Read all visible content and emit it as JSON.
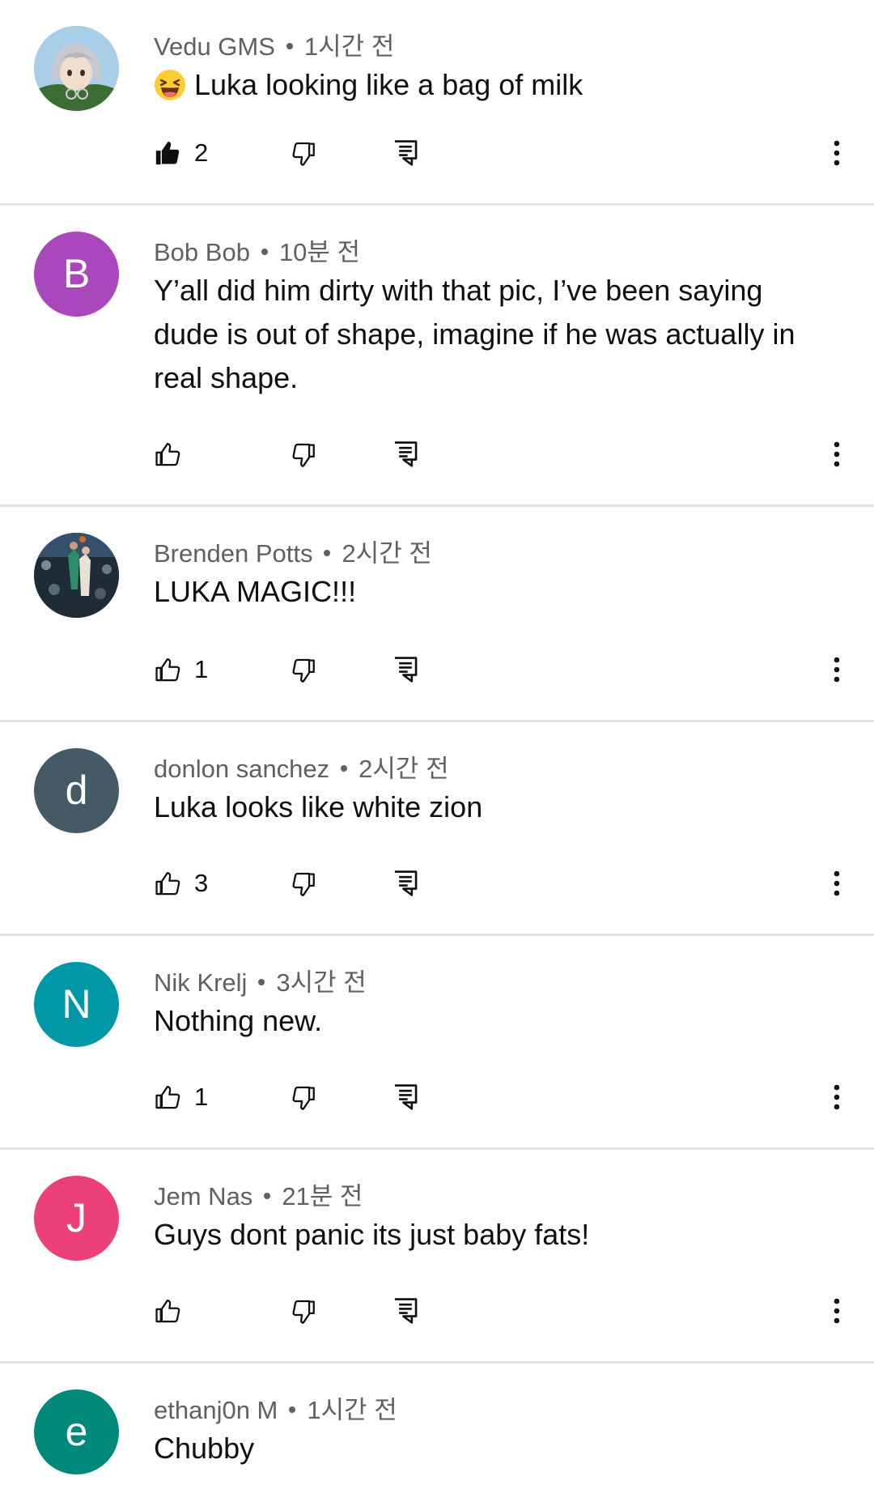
{
  "comments": [
    {
      "author": "Vedu GMS",
      "time": "1시간 전",
      "text": "Luka looking like a bag of milk",
      "emoji": "laughing-face",
      "likes": "2",
      "liked": true,
      "avatar": {
        "type": "image",
        "desc": "anime-character",
        "color": "#9fc6e6"
      }
    },
    {
      "author": "Bob Bob",
      "time": "10분 전",
      "text": "Y’all did him dirty with that pic, I’ve been saying dude is out of shape, imagine if he was actually in real shape.",
      "likes": "",
      "liked": false,
      "avatar": {
        "type": "letter",
        "letter": "B",
        "color": "#ab47bc"
      }
    },
    {
      "author": "Brenden Potts",
      "time": "2시간 전",
      "text": "LUKA MAGIC!!!",
      "likes": "1",
      "liked": false,
      "avatar": {
        "type": "image",
        "desc": "basketball-photo",
        "color": "#2b3f4f"
      }
    },
    {
      "author": "donlon sanchez",
      "time": "2시간 전",
      "text": "Luka looks like white zion",
      "likes": "3",
      "liked": false,
      "avatar": {
        "type": "letter",
        "letter": "d",
        "color": "#455a64"
      }
    },
    {
      "author": "Nik Krelj",
      "time": "3시간 전",
      "text": "Nothing new.",
      "likes": "1",
      "liked": false,
      "avatar": {
        "type": "letter",
        "letter": "N",
        "color": "#0097a7"
      }
    },
    {
      "author": "Jem Nas",
      "time": "21분 전",
      "text": "Guys dont panic its just baby fats!",
      "likes": "",
      "liked": false,
      "avatar": {
        "type": "letter",
        "letter": "J",
        "color": "#ec407a"
      }
    },
    {
      "author": "ethanj0n M",
      "time": "1시간 전",
      "text": "Chubby",
      "likes": "",
      "liked": false,
      "avatar": {
        "type": "letter",
        "letter": "e",
        "color": "#00897b"
      }
    }
  ],
  "icons": {
    "like": "thumb-up-icon",
    "dislike": "thumb-down-icon",
    "reply": "reply-icon",
    "more": "more-vertical-icon"
  },
  "colors": {
    "text": "#0f0f0f",
    "meta": "#606060",
    "divider": "#e3e3e3"
  }
}
